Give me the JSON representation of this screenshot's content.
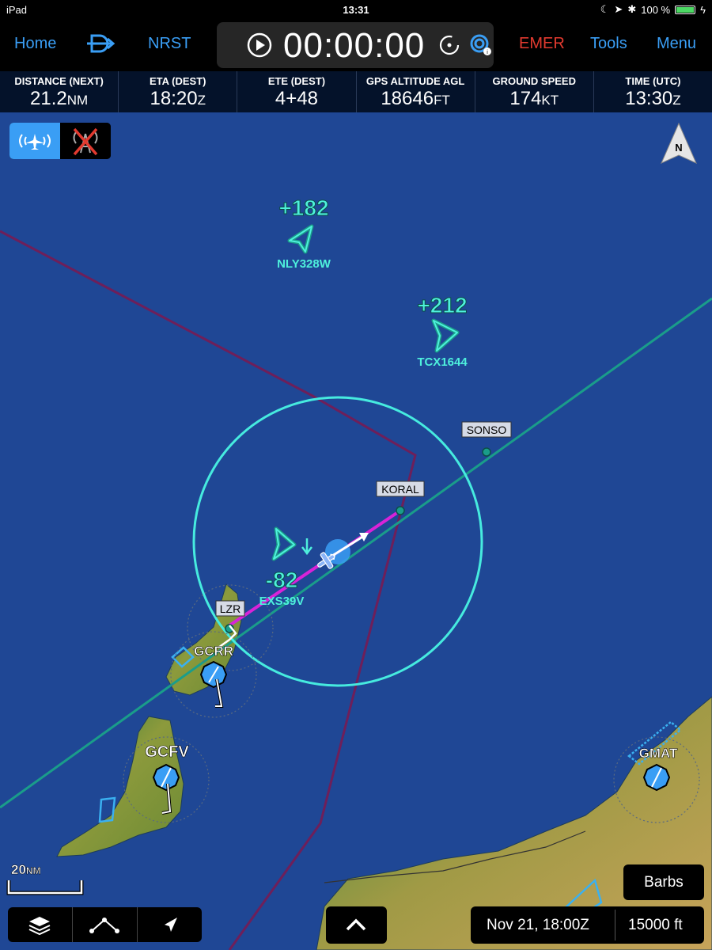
{
  "status_bar": {
    "device": "iPad",
    "time": "13:31",
    "battery": "100 %"
  },
  "top_bar": {
    "home": "Home",
    "direct_to_icon": "direct-to-icon",
    "nrst": "NRST",
    "timer": "00:00:00",
    "emer": "EMER",
    "tools": "Tools",
    "menu": "Menu"
  },
  "data_fields": [
    {
      "label": "DISTANCE (NEXT)",
      "value": "21.2",
      "unit": "NM"
    },
    {
      "label": "ETA (DEST)",
      "value": "18:20",
      "unit": "Z"
    },
    {
      "label": "ETE (DEST)",
      "value": "4+48",
      "unit": ""
    },
    {
      "label": "GPS ALTITUDE AGL",
      "value": "18646",
      "unit": "FT"
    },
    {
      "label": "GROUND SPEED",
      "value": "174",
      "unit": "KT"
    },
    {
      "label": "TIME (UTC)",
      "value": "13:30",
      "unit": "Z"
    }
  ],
  "map": {
    "north_label": "N",
    "traffic": [
      {
        "alt": "+182",
        "callsign": "NLY328W"
      },
      {
        "alt": "+212",
        "callsign": "TCX1644"
      },
      {
        "alt": "-82",
        "callsign": "EXS39V"
      }
    ],
    "waypoints": [
      "SONSO",
      "KORAL",
      "LZR"
    ],
    "airports": [
      "GCRR",
      "GCFV",
      "GMAT"
    ],
    "scale": {
      "value": "20",
      "unit": "NM"
    }
  },
  "bottom": {
    "barbs": "Barbs",
    "date": "Nov 21, 18:00Z",
    "altitude": "15000 ft"
  },
  "colors": {
    "ocean": "#1f4795",
    "route": "#1a9d8a",
    "active_leg": "#d823d8",
    "boundary": "#6e1f5a",
    "range_ring": "#46ebdf",
    "traffic": "#4ef0dc",
    "accent": "#3a9ef5",
    "emergency": "#e23a2f"
  }
}
